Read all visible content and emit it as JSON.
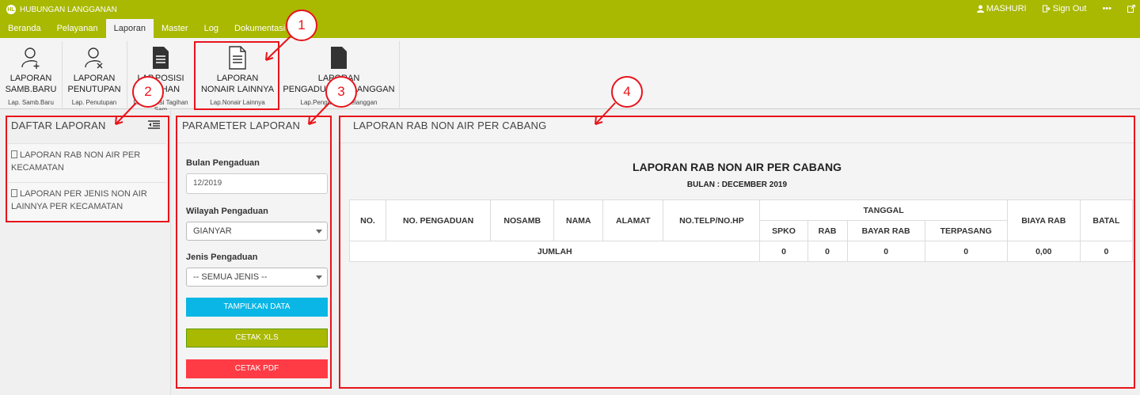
{
  "app": {
    "title": "HUBUNGAN LANGGANAN",
    "logo_text": "HL"
  },
  "user": {
    "name": "MASHURI",
    "sign_out": "Sign Out",
    "more": "•••"
  },
  "menu": {
    "tabs": [
      "Beranda",
      "Pelayanan",
      "Laporan",
      "Master",
      "Log",
      "Dokumentasi"
    ],
    "active": "Laporan"
  },
  "ribbon": {
    "buttons": [
      {
        "label_line1": "LAPORAN",
        "label_line2": "SAMB.BARU",
        "group": "Lap. Samb.Baru",
        "icon": "user-add-icon"
      },
      {
        "label_line1": "LAPORAN",
        "label_line2": "PENUTUPAN",
        "group": "Lap. Penutupan",
        "icon": "user-remove-icon"
      },
      {
        "label_line1": "LAP.POSISI",
        "label_line2": "TAGIHAN",
        "group": "Lap. Posisi Tagihan Sam",
        "icon": "document-icon"
      },
      {
        "label_line1": "LAPORAN",
        "label_line2": "NONAIR LAINNYA",
        "group": "Lap.Nonair Lainnya",
        "icon": "document-outline-icon"
      },
      {
        "label_line1": "LAPORAN",
        "label_line2": "PENGADUAN PELANGGAN",
        "group": "Lap.Pengaduan Pelanggan",
        "icon": "document-icon"
      }
    ]
  },
  "daftar": {
    "title": "DAFTAR LAPORAN",
    "items": [
      "LAPORAN RAB NON AIR PER KECAMATAN",
      "LAPORAN PER JENIS NON AIR LAINNYA PER KECAMATAN"
    ]
  },
  "parameter": {
    "title": "PARAMETER LAPORAN",
    "bulan_label": "Bulan Pengaduan",
    "bulan_value": "12/2019",
    "wilayah_label": "Wilayah Pengaduan",
    "wilayah_value": "GIANYAR",
    "jenis_label": "Jenis Pengaduan",
    "jenis_value": "-- SEMUA JENIS --",
    "btn_tampilkan": "TAMPILKAN DATA",
    "btn_xls": "CETAK XLS",
    "btn_pdf": "CETAK PDF"
  },
  "report": {
    "panel_title": "LAPORAN RAB NON AIR PER CABANG",
    "title": "LAPORAN RAB NON AIR PER CABANG",
    "subtitle": "BULAN : DECEMBER 2019",
    "headers": {
      "no": "NO.",
      "no_pengaduan": "NO. PENGADUAN",
      "nosamb": "NOSAMB",
      "nama": "NAMA",
      "alamat": "ALAMAT",
      "telp": "NO.TELP/NO.HP",
      "tanggal": "TANGGAL",
      "spko": "SPKO",
      "rab": "RAB",
      "bayar_rab": "BAYAR RAB",
      "terpasang": "TERPASANG",
      "biaya_rab": "BIAYA RAB",
      "batal": "BATAL"
    },
    "total_row": {
      "label": "JUMLAH",
      "spko": "0",
      "rab": "0",
      "bayar_rab": "0",
      "terpasang": "0",
      "biaya_rab": "0,00",
      "batal": "0"
    }
  },
  "annotations": [
    "1",
    "2",
    "3",
    "4"
  ],
  "colors": {
    "topbar": "#a9b800",
    "annotation": "#e8141b",
    "btn_cyan": "#09b6e6",
    "btn_red": "#ff3b45"
  }
}
